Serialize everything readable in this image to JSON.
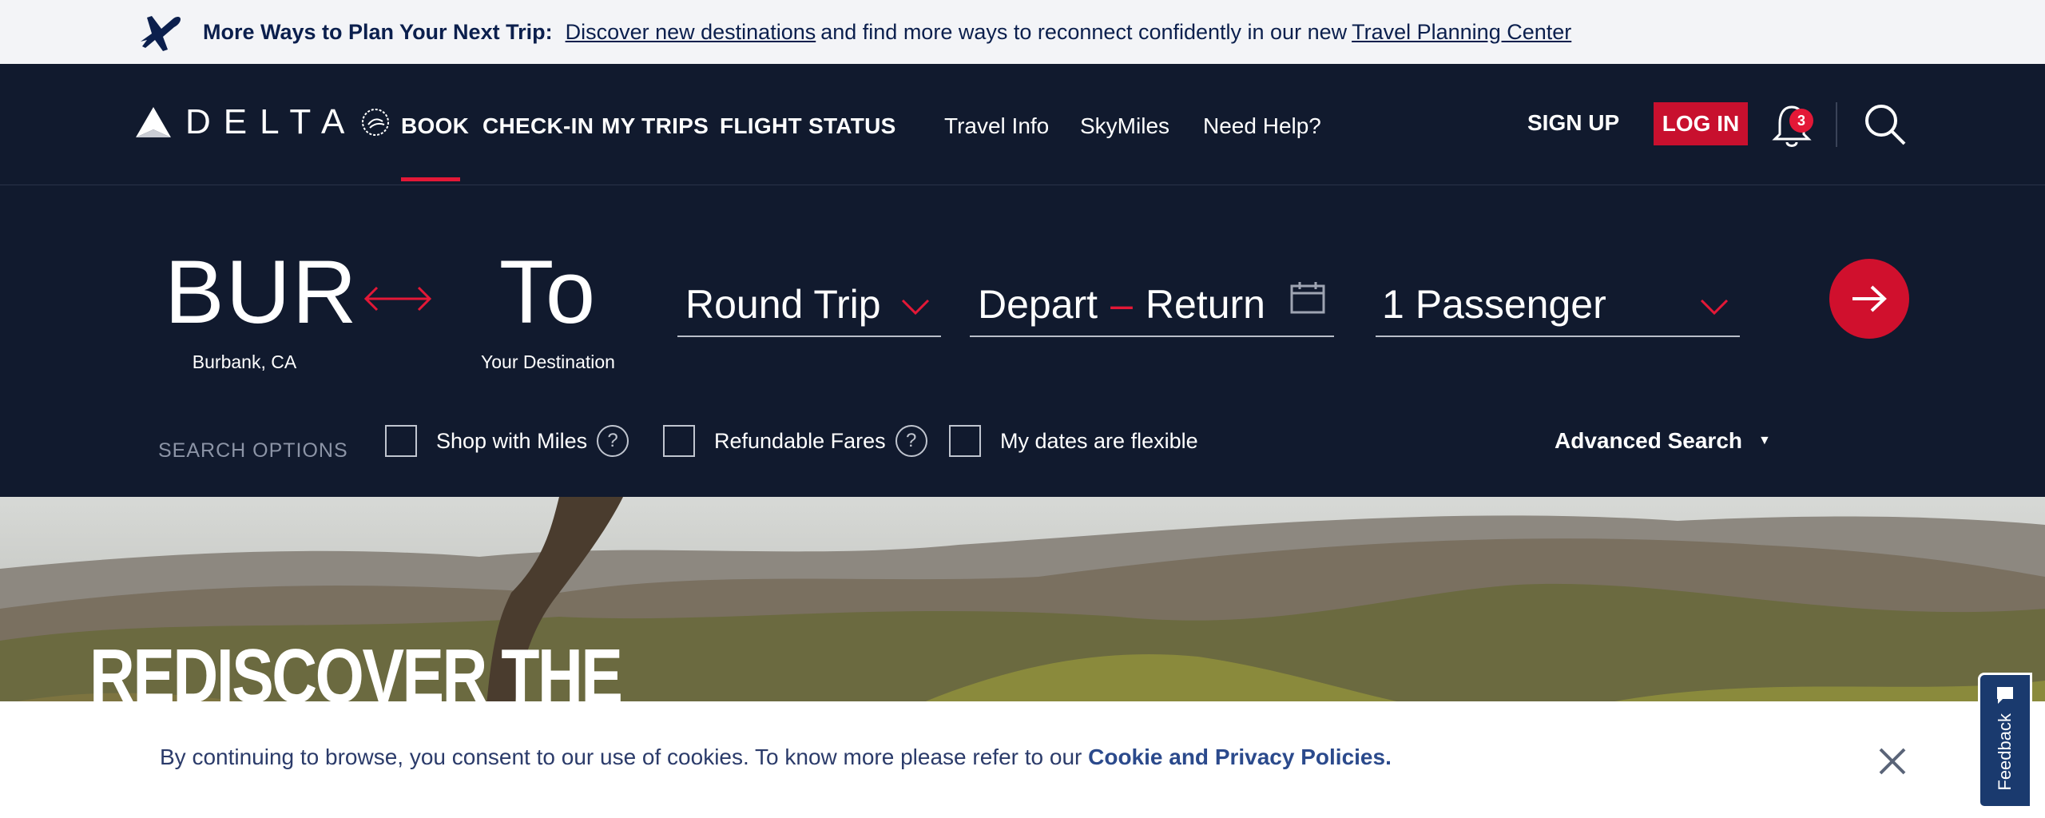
{
  "banner": {
    "lead": "More Ways to Plan Your Next Trip:",
    "link1": "Discover new destinations",
    "mid": "and find more ways to reconnect confidently in our new",
    "link2": "Travel Planning Center"
  },
  "nav": {
    "logo_text": "DELTA",
    "primary": [
      "BOOK",
      "CHECK-IN",
      "MY TRIPS",
      "FLIGHT STATUS"
    ],
    "secondary": [
      "Travel Info",
      "SkyMiles",
      "Need Help?"
    ],
    "signup": "SIGN UP",
    "login": "LOG IN",
    "notifications": "3"
  },
  "booking": {
    "from_code": "BUR",
    "from_city": "Burbank, CA",
    "to_code": "To",
    "to_city": "Your Destination",
    "trip_type": "Round Trip",
    "depart": "Depart",
    "return": "Return",
    "passengers": "1 Passenger",
    "options_label": "SEARCH OPTIONS",
    "opt_miles": "Shop with Miles",
    "opt_refund": "Refundable Fares",
    "opt_flexible": "My dates are flexible",
    "advanced": "Advanced Search",
    "help_glyph": "?"
  },
  "hero": {
    "title": "REDISCOVER THE"
  },
  "cookie": {
    "text": "By continuing to browse, you consent to our use of cookies. To know more please refer to our",
    "link": "Cookie and Privacy Policies."
  },
  "feedback": {
    "label": "Feedback"
  },
  "colors": {
    "navy": "#111a2e",
    "red": "#e31837",
    "banner_text": "#0b1f4d"
  }
}
